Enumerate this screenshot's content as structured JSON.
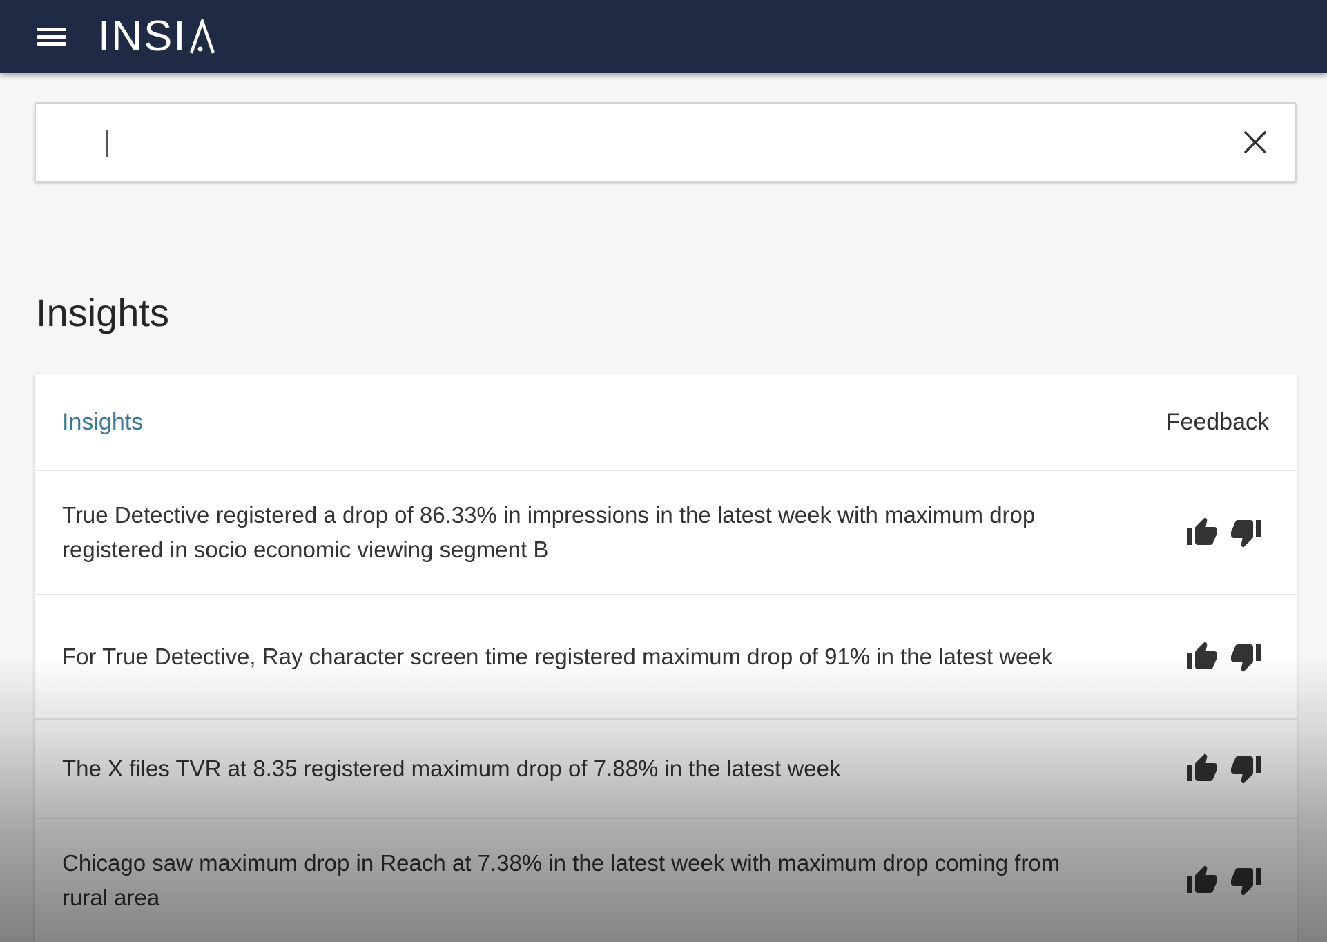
{
  "header": {
    "logo_text": "INSIA",
    "logo_main": "INSI"
  },
  "search": {
    "value": "",
    "placeholder": ""
  },
  "section": {
    "title": "Insights"
  },
  "table": {
    "columns": {
      "insights": "Insights",
      "feedback": "Feedback"
    },
    "rows": [
      {
        "text": "True Detective registered a drop of 86.33% in impressions in the latest week with maximum drop registered in socio economic viewing segment B"
      },
      {
        "text": "For True Detective, Ray character screen time registered maximum drop of 91% in the latest week"
      },
      {
        "text": "The X files TVR at 8.35 registered maximum drop of 7.88% in the latest week"
      },
      {
        "text": "Chicago saw maximum drop in Reach at 7.38% in the latest week with maximum drop coming from rural area"
      }
    ]
  },
  "icons": {
    "menu": "hamburger-menu-icon",
    "clear": "close-icon",
    "like": "thumbs-up-icon",
    "dislike": "thumbs-down-icon"
  },
  "colors": {
    "topbar": "#1f2b44",
    "accent_link": "#3a7a94",
    "background": "#f6f6f6"
  }
}
